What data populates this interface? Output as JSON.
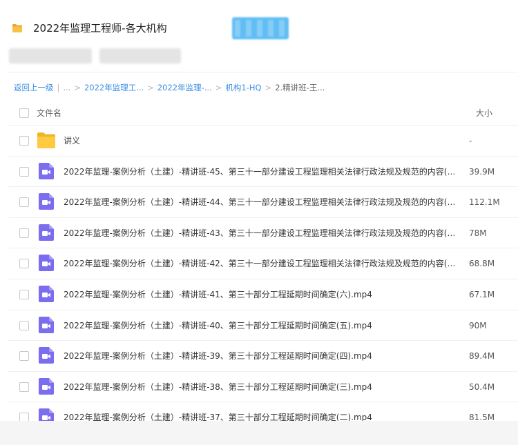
{
  "header": {
    "title": "2022年监理工程师-各大机构"
  },
  "breadcrumb": {
    "back": "返回上一级",
    "ellipsis": "...",
    "items": [
      "2022年监理工...",
      "2022年监理-...",
      "机构1-HQ"
    ],
    "current": "2.精讲班-王..."
  },
  "table": {
    "col_name": "文件名",
    "col_size": "大小"
  },
  "files": [
    {
      "name": "讲义",
      "size": "-",
      "type": "folder"
    },
    {
      "name": "2022年监理-案例分析（土建）-精讲班-45、第三十一部分建设工程监理相关法律行政法规及规范的内容(四...",
      "size": "39.9M",
      "type": "video"
    },
    {
      "name": "2022年监理-案例分析（土建）-精讲班-44、第三十一部分建设工程监理相关法律行政法规及规范的内容(三...",
      "size": "112.1M",
      "type": "video"
    },
    {
      "name": "2022年监理-案例分析（土建）-精讲班-43、第三十一部分建设工程监理相关法律行政法规及规范的内容(二...",
      "size": "78M",
      "type": "video"
    },
    {
      "name": "2022年监理-案例分析（土建）-精讲班-42、第三十一部分建设工程监理相关法律行政法规及规范的内容(一...",
      "size": "68.8M",
      "type": "video"
    },
    {
      "name": "2022年监理-案例分析（土建）-精讲班-41、第三十部分工程延期时间确定(六).mp4",
      "size": "67.1M",
      "type": "video"
    },
    {
      "name": "2022年监理-案例分析（土建）-精讲班-40、第三十部分工程延期时间确定(五).mp4",
      "size": "90M",
      "type": "video"
    },
    {
      "name": "2022年监理-案例分析（土建）-精讲班-39、第三十部分工程延期时间确定(四).mp4",
      "size": "89.4M",
      "type": "video"
    },
    {
      "name": "2022年监理-案例分析（土建）-精讲班-38、第三十部分工程延期时间确定(三).mp4",
      "size": "50.4M",
      "type": "video"
    },
    {
      "name": "2022年监理-案例分析（土建）-精讲班-37、第三十部分工程延期时间确定(二).mp4",
      "size": "81.5M",
      "type": "video"
    }
  ],
  "colors": {
    "link": "#3a8ee6",
    "folder": "#ffc940",
    "video": "#7b6df0"
  }
}
